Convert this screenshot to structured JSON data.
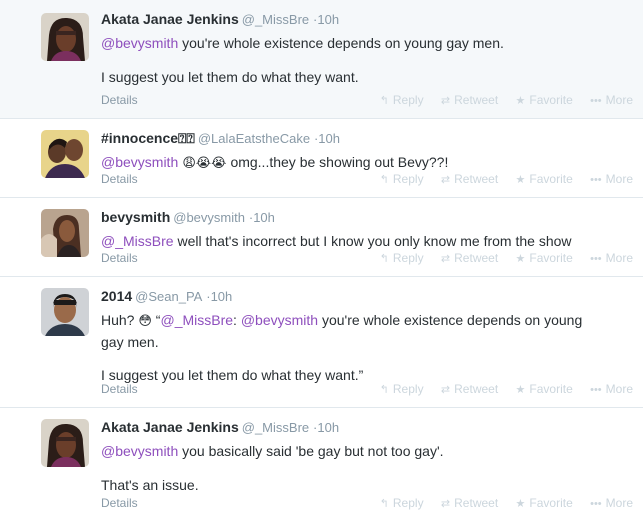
{
  "tweets": [
    {
      "fullname": "Akata Janae Jenkins",
      "username": "@_MissBre",
      "time": "10h",
      "line1_mention": "@bevysmith",
      "line1_text": " you're whole existence depends on young gay men.",
      "line2_text": "I suggest you let them do what they want.",
      "details": "Details"
    },
    {
      "fullname": "#innocence",
      "username": "@LalaEatstheCake",
      "time": "10h",
      "line1_mention": "@bevysmith",
      "emoji": " 😩😭😭 ",
      "line1_text": "omg...they be showing out Bevy??!",
      "details": "Details"
    },
    {
      "fullname": "bevysmith",
      "username": "@bevysmith",
      "time": "10h",
      "line1_mention": "@_MissBre",
      "line1_text": " well that's incorrect but I know you only know me from the show",
      "details": "Details"
    },
    {
      "fullname": "2014",
      "username": "@Sean_PA",
      "time": "10h",
      "prefix": "Huh? ",
      "emoji": "😳",
      "quote_open": " “",
      "line1_mention": "@_MissBre",
      "colon": ": ",
      "line1_mention2": "@bevysmith",
      "line1_text": " you're whole existence depends on young",
      "line1b_text": "gay men.",
      "line2_text": "I suggest you let them do what they want.”",
      "details": "Details"
    },
    {
      "fullname": "Akata Janae Jenkins",
      "username": "@_MissBre",
      "time": "10h",
      "line1_mention": "@bevysmith",
      "line1_text": " you basically said 'be gay but not too gay'.",
      "line2_text": "That's an issue.",
      "details": "Details"
    }
  ],
  "actions": {
    "reply": "Reply",
    "retweet": "Retweet",
    "favorite": "Favorite",
    "more": "More",
    "reply_icon": "reply-icon",
    "retweet_icon": "retweet-icon",
    "favorite_icon": "star-icon",
    "more_icon": "ellipsis-icon"
  },
  "separator": "·",
  "colors": {
    "mention": "#8e4fbd",
    "muted": "#8899a6",
    "action": "#ccd6dd",
    "border": "#e1e8ed"
  }
}
